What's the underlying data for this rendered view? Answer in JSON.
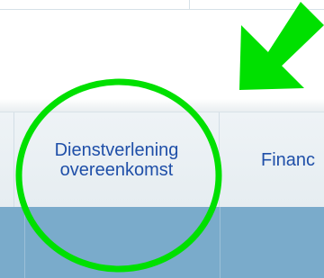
{
  "nav": {
    "tabs": [
      {
        "label_line1": "Dienstverlening",
        "label_line2": "overeenkomst"
      },
      {
        "label": "Financ"
      }
    ]
  },
  "annotations": {
    "highlight_color": "#00e000",
    "arrow_icon": "arrow-down-left-icon",
    "circle_icon": "highlight-circle"
  },
  "colors": {
    "link": "#1f4fa8",
    "bar": "#7aabcb"
  }
}
